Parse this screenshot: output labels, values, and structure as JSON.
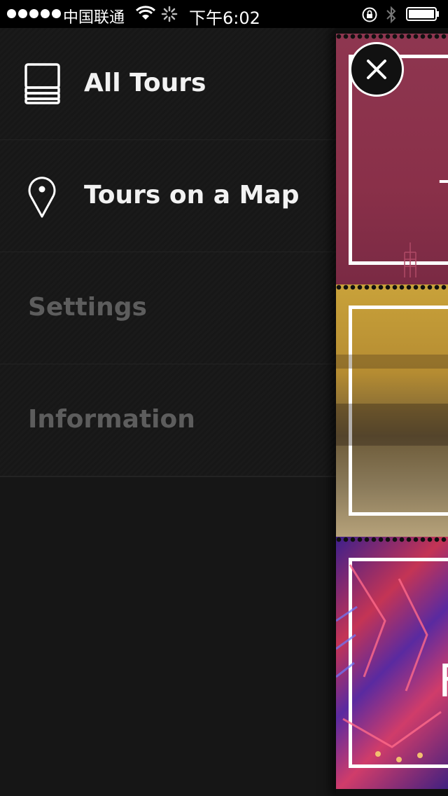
{
  "status_bar": {
    "carrier": "中国联通",
    "time": "下午6:02"
  },
  "menu": {
    "items": [
      {
        "label": "All Tours",
        "icon": "stack-icon",
        "enabled": true
      },
      {
        "label": "Tours on a Map",
        "icon": "map-pin-icon",
        "enabled": true
      },
      {
        "label": "Settings",
        "enabled": false
      },
      {
        "label": "Information",
        "enabled": false
      }
    ]
  },
  "cards": [
    {
      "glyph": "T",
      "color": "#8a3049"
    },
    {
      "glyph": "",
      "color": "#b58c32"
    },
    {
      "glyph": "F",
      "color": "#c43455"
    }
  ],
  "close_button": {
    "icon": "close-icon"
  },
  "colors": {
    "background": "#161616",
    "muted_text": "#5d5d5d",
    "text": "#f2f2f2"
  }
}
